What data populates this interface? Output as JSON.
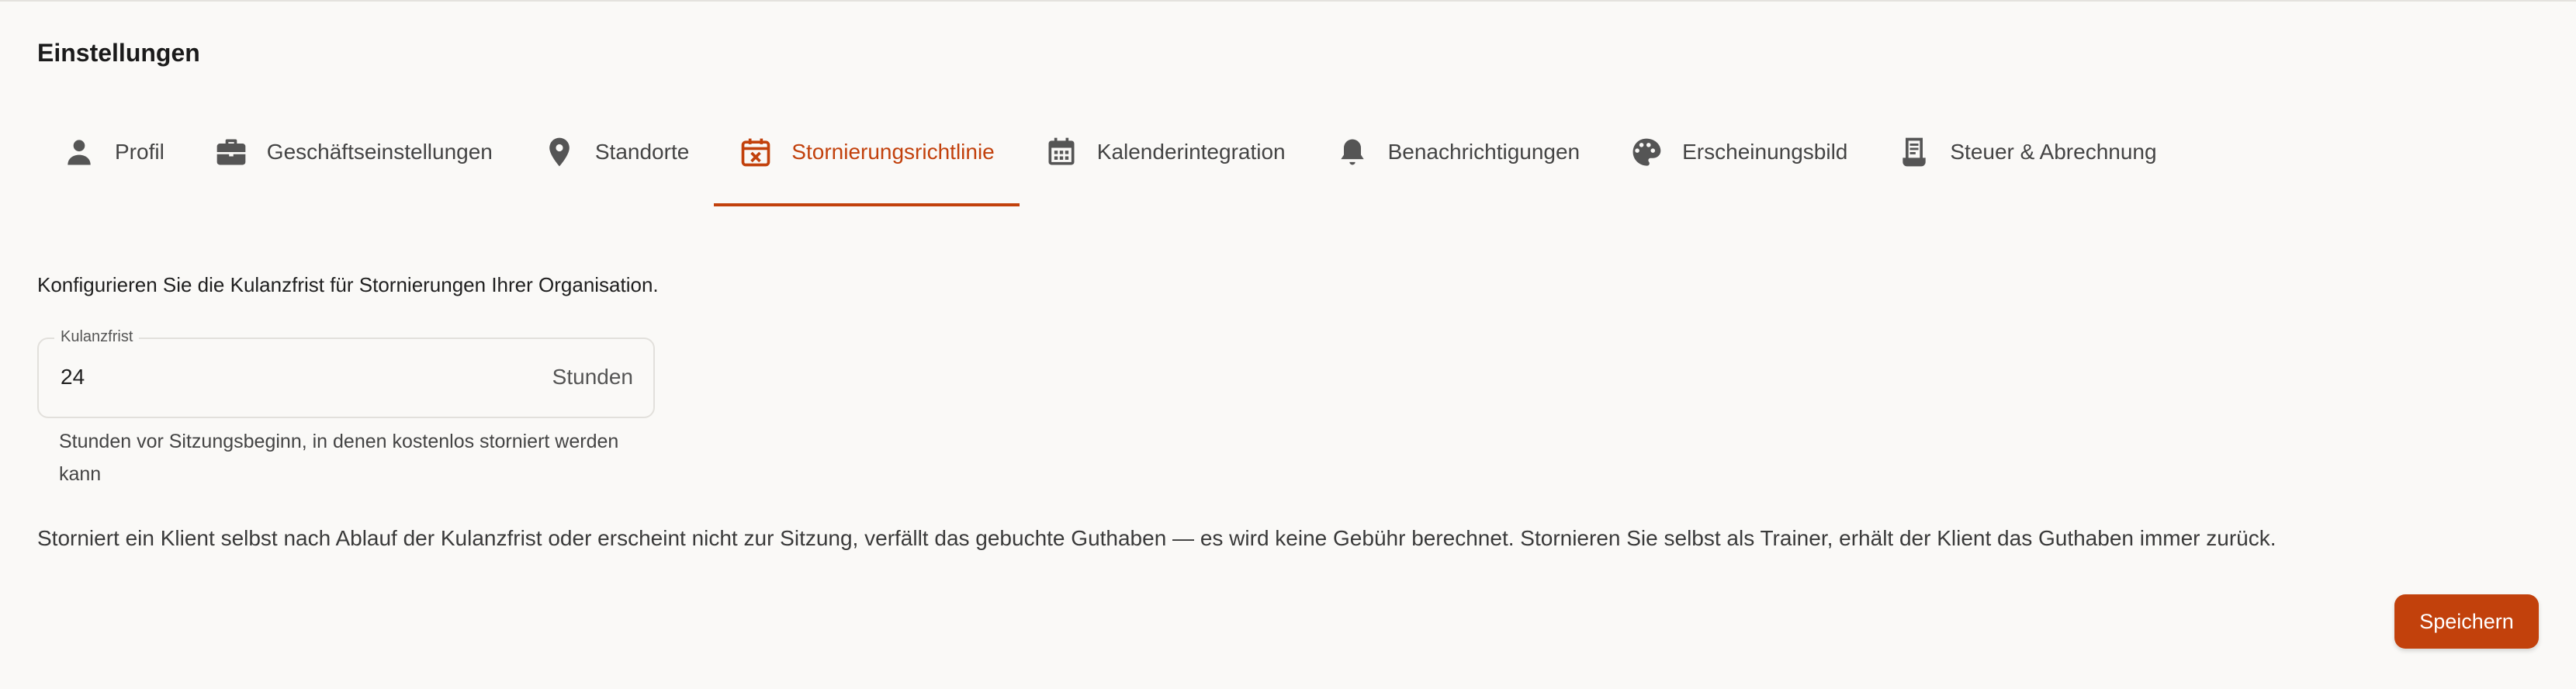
{
  "page": {
    "title": "Einstellungen"
  },
  "tabs": [
    {
      "label": "Profil",
      "icon": "person-icon"
    },
    {
      "label": "Geschäftseinstellungen",
      "icon": "briefcase-icon"
    },
    {
      "label": "Standorte",
      "icon": "location-pin-icon"
    },
    {
      "label": "Stornierungsrichtlinie",
      "icon": "calendar-cancel-icon",
      "active": true
    },
    {
      "label": "Kalenderintegration",
      "icon": "calendar-icon"
    },
    {
      "label": "Benachrichtigungen",
      "icon": "bell-icon"
    },
    {
      "label": "Erscheinungsbild",
      "icon": "palette-icon"
    },
    {
      "label": "Steuer & Abrechnung",
      "icon": "receipt-icon"
    }
  ],
  "cancellation": {
    "description": "Konfigurieren Sie die Kulanzfrist für Stornierungen Ihrer Organisation.",
    "grace_period": {
      "label": "Kulanzfrist",
      "value": "24",
      "unit": "Stunden",
      "helper": "Stunden vor Sitzungsbeginn, in denen kostenlos storniert werden kann"
    },
    "info": "Storniert ein Klient selbst nach Ablauf der Kulanzfrist oder erscheint nicht zur Sitzung, verfällt das gebuchte Guthaben — es wird keine Gebühr berechnet. Stornieren Sie selbst als Trainer, erhält der Klient das Guthaben immer zurück.",
    "save_label": "Speichern"
  },
  "colors": {
    "accent": "#c2410c",
    "background": "#faf9f7",
    "text": "#1f1f1f",
    "icon": "#555555"
  }
}
